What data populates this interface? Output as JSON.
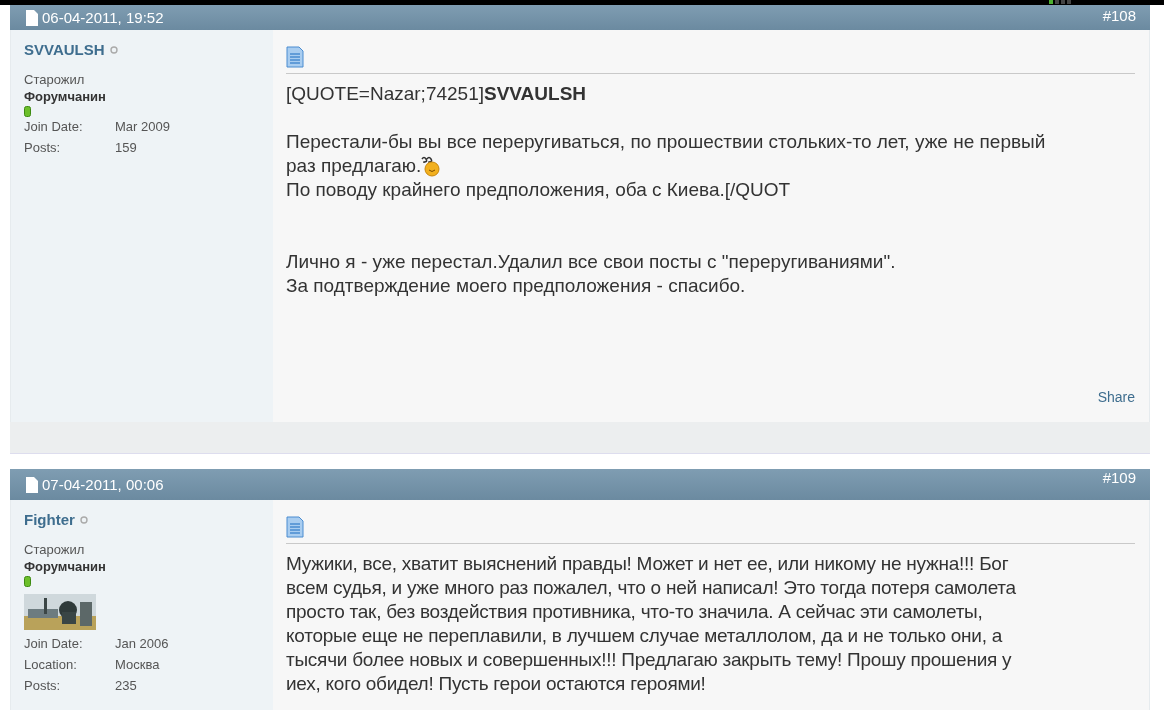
{
  "posts": [
    {
      "date": "06-04-2011, 19:52",
      "number": "#108",
      "author": {
        "name": "SVVAULSH",
        "online": false,
        "title": "Старожил",
        "rank": "Форумчанин",
        "info": [
          {
            "label": "Join Date:",
            "value": "Mar 2009"
          },
          {
            "label": "Posts:",
            "value": "159"
          }
        ]
      },
      "paragraphs": [
        {
          "lines": [
            {
              "text": "[QUOTE=Nazar;74251]**SVVAULSH**"
            }
          ]
        },
        {
          "lines": [
            {
              "text": "Перестали-бы вы все переругиваться, по прошествии стольких-то лет, уже не первый"
            },
            {
              "text": "раз предлагаю.",
              "smiley": true
            },
            {
              "text": "По поводу крайнего предположения, оба с Киева.[/QUOT"
            }
          ]
        },
        {
          "lines": [
            {
              "text": "Лично я - уже перестал.Удалил все свои посты с \"переругиваниями\"."
            },
            {
              "text": "За подтверждение моего предположения - спасибо."
            }
          ]
        }
      ],
      "share": "Share"
    },
    {
      "date": "07-04-2011, 00:06",
      "number": "#109",
      "author": {
        "name": "Fighter",
        "online": false,
        "title": "Старожил",
        "rank": "Форумчанин",
        "avatar": true,
        "info": [
          {
            "label": "Join Date:",
            "value": "Jan 2006"
          },
          {
            "label": "Location:",
            "value": "Москва"
          },
          {
            "label": "Posts:",
            "value": "235"
          }
        ]
      },
      "paragraphs": [
        {
          "lines": [
            {
              "text": "Мужики, все, хватит выяснений правды! Может и нет ее, или никому не нужна!!! Бог"
            },
            {
              "text": "всем судья, и уже много раз пожалел, что о ней написал! Это тогда потеря самолета"
            },
            {
              "text": "просто так, без воздействия противника, что-то значила. А сейчас эти самолеты,"
            },
            {
              "text": "которые еще не переплавили, в лучшем случае металлолом, да и не только они, а"
            },
            {
              "text": "тысячи более новых и совершенных!!! Предлагаю закрыть тему! Прошу прошения у"
            },
            {
              "text": "иех, кого обидел! Пусть герои остаются героями!"
            }
          ]
        }
      ]
    }
  ]
}
